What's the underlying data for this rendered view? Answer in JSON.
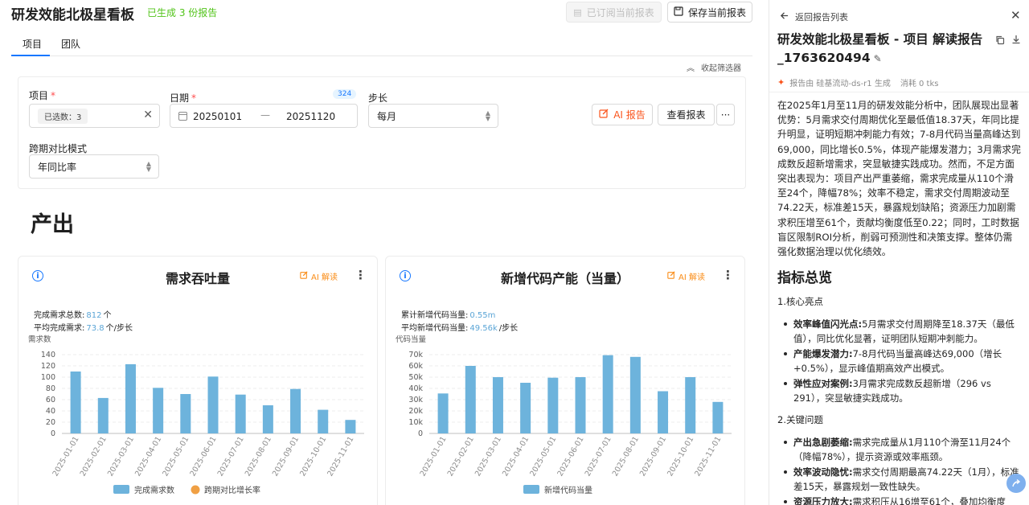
{
  "header": {
    "title": "研发效能北极星看板",
    "generated": "已生成 3 份报告",
    "subscribed_btn": "已订阅当前报表",
    "save_btn": "保存当前报表"
  },
  "tabs": [
    {
      "label": "项目",
      "active": true
    },
    {
      "label": "团队",
      "active": false
    }
  ],
  "collapse_label": "收起筛选器",
  "filters": {
    "project_label": "项目",
    "project_tag": "已选数：3",
    "date_label": "日期",
    "date_badge": "324",
    "date_start": "20250101",
    "date_sep": "—",
    "date_end": "20251120",
    "step_label": "步长",
    "step_value": "每月",
    "compare_label": "跨期对比模式",
    "compare_value": "年同比率",
    "ai_report_btn": "AI 报告",
    "view_report_btn": "查看报表",
    "more_btn": "···"
  },
  "section_title": "产出",
  "cards": [
    {
      "title": "需求吞吐量",
      "ai_label": "AI 解读",
      "stat1_label": "完成需求总数:",
      "stat1_value": "812",
      "stat1_unit": "个",
      "stat2_label": "平均完成需求:",
      "stat2_value": "73.8",
      "stat2_unit": "个/步长"
    },
    {
      "title": "新增代码产能（当量）",
      "ai_label": "AI 解读",
      "stat1_label": "累计新增代码当量:",
      "stat1_value": "0.55m",
      "stat1_unit": "",
      "stat2_label": "平均新增代码当量:",
      "stat2_value": "49.56k",
      "stat2_unit": "/步长"
    }
  ],
  "chart_data": [
    {
      "type": "bar",
      "ylabel": "需求数",
      "categories": [
        "2025-01-01",
        "2025-02-01",
        "2025-03-01",
        "2025-04-01",
        "2025-05-01",
        "2025-06-01",
        "2025-07-01",
        "2025-08-01",
        "2025-09-01",
        "2025-10-01",
        "2025-11-01"
      ],
      "series": [
        {
          "name": "完成需求数",
          "values": [
            110,
            63,
            123,
            81,
            70,
            101,
            69,
            50,
            79,
            42,
            24
          ],
          "color": "#6db3dc"
        },
        {
          "name": "跨期对比增长率",
          "values": [],
          "color": "#f0a044"
        }
      ],
      "ylim": [
        0,
        140
      ],
      "yticks": [
        "0",
        "20",
        "40",
        "60",
        "80",
        "100",
        "120",
        "140"
      ],
      "grid": true,
      "legend": "bottom"
    },
    {
      "type": "bar",
      "ylabel": "代码当量",
      "categories": [
        "2025-01-01",
        "2025-02-01",
        "2025-03-01",
        "2025-04-01",
        "2025-05-01",
        "2025-06-01",
        "2025-07-01",
        "2025-08-01",
        "2025-09-01",
        "2025-10-01",
        "2025-11-01"
      ],
      "series": [
        {
          "name": "新增代码当量",
          "values": [
            35500,
            60000,
            50000,
            45000,
            49500,
            50000,
            69500,
            68000,
            37500,
            50000,
            28000
          ],
          "color": "#6db3dc"
        }
      ],
      "ylim": [
        0,
        70000
      ],
      "yticks": [
        "0",
        "10k",
        "20k",
        "30k",
        "40k",
        "50k",
        "60k",
        "70k"
      ],
      "grid": true,
      "legend": "bottom"
    }
  ],
  "panel": {
    "back_label": "返回报告列表",
    "title": "研发效能北极星看板 - 项目 解读报告 _1763620494",
    "meta_by": "报告由 硅基流动-ds-r1 生成",
    "meta_tokens": "消耗 0 tks",
    "summary": "在2025年1月至11月的研发效能分析中，团队展现出显著优势：5月需求交付周期优化至最低值18.37天，年同比提升明显，证明短期冲刺能力有效；7-8月代码当量高峰达到69,000，同比增长0.5%，体现产能爆发潜力；3月需求完成数反超新增需求，突显敏捷实践成功。然而，不足方面突出表现为：项目产出严重萎缩，需求完成量从110个滑至24个，降幅78%；效率不稳定，需求交付周期波动至74.22天，标准差15天，暴露规划缺陷；资源压力加剧需求积压增至61个，贡献均衡度低至0.22；同时，工时数据盲区限制ROI分析，削弱可预测性和决策支撑。整体仍需强化数据治理以优化绩效。",
    "h2": "指标总览",
    "sec1_title": "1.核心亮点",
    "sec1_items": [
      {
        "bold": "效率峰值闪光点:",
        "text": "5月需求交付周期降至18.37天（最低值），同比优化显著，证明团队短期冲刺能力。"
      },
      {
        "bold": "产能爆发潜力:",
        "text": "7-8月代码当量高峰达69,000（增长+0.5%），显示峰值期高效产出模式。"
      },
      {
        "bold": "弹性应对案例:",
        "text": "3月需求完成数反超新增（296 vs 291），突显敏捷实践成功。"
      }
    ],
    "sec2_title": "2.关键问题",
    "sec2_items": [
      {
        "bold": "产出急剧萎缩:",
        "text": "需求完成量从1月110个滑至11月24个（降幅78%），提示资源或效率瓶颈。"
      },
      {
        "bold": "效率波动隐忧:",
        "text": "需求交付周期最高74.22天（1月），标准差15天，暴露规划一致性缺失。"
      },
      {
        "bold": "资源压力放大:",
        "text": "需求积压从16增至61个，叠加均衡度"
      }
    ]
  }
}
